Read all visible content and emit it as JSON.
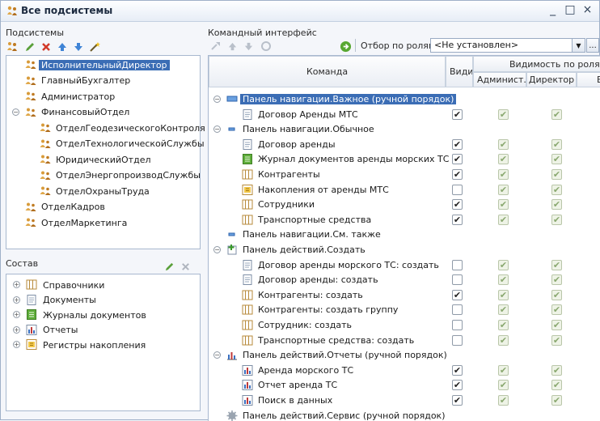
{
  "window": {
    "title": "Все подсистемы",
    "controls": [
      "_",
      "□",
      "×"
    ]
  },
  "subsystems": {
    "label": "Подсистемы",
    "items": [
      {
        "label": "ИсполнительныйДиректор",
        "selected": true,
        "level": 0
      },
      {
        "label": "ГлавныйБухгалтер",
        "level": 0
      },
      {
        "label": "Администратор",
        "level": 0
      },
      {
        "label": "ФинансовыйОтдел",
        "level": 0,
        "expanded": true
      },
      {
        "label": "ОтделГеодезическогоКонтроля",
        "level": 1
      },
      {
        "label": "ОтделТехнологическойСлужбы",
        "level": 1
      },
      {
        "label": "ЮридическийОтдел",
        "level": 1
      },
      {
        "label": "ОтделЭнергопроизводСлужбы",
        "level": 1
      },
      {
        "label": "ОтделОхраныТруда",
        "level": 1
      },
      {
        "label": "ОтделКадров",
        "level": 0
      },
      {
        "label": "ОтделМаркетинга",
        "level": 0
      }
    ]
  },
  "composition": {
    "label": "Состав",
    "items": [
      {
        "label": "Справочники",
        "icon": "catalog-icon"
      },
      {
        "label": "Документы",
        "icon": "document-icon"
      },
      {
        "label": "Журналы документов",
        "icon": "journal-icon"
      },
      {
        "label": "Отчеты",
        "icon": "report-icon"
      },
      {
        "label": "Регистры накопления",
        "icon": "register-icon"
      }
    ]
  },
  "command_interface": {
    "label": "Командный интерфейс",
    "filter_label": "Отбор по ролям:",
    "filter_value": "<Не установлен>",
    "dots": "...",
    "headers": {
      "command": "Команда",
      "visible": "Види...",
      "visibility_by_roles": "Видимость по ролям",
      "role1": "Админист...",
      "role2": "Директор",
      "role3": "Б"
    },
    "rows": [
      {
        "label": "Панель навигации.Важное (ручной порядок)",
        "type": "group",
        "icon": "nav-panel-icon",
        "selected": true
      },
      {
        "label": "Договор Аренды МТС",
        "icon": "document-icon",
        "visible": true,
        "indent": 1
      },
      {
        "label": "Панель навигации.Обычное",
        "type": "group",
        "icon": "nav-panel-small-icon"
      },
      {
        "label": "Договор аренды",
        "icon": "document-icon",
        "visible": true,
        "indent": 1
      },
      {
        "label": "Журнал документов аренды морских ТС",
        "icon": "journal-icon",
        "visible": true,
        "indent": 1
      },
      {
        "label": "Контрагенты",
        "icon": "catalog-icon",
        "visible": true,
        "indent": 1
      },
      {
        "label": "Накопления от аренды МТС",
        "icon": "register-icon",
        "visible": false,
        "indent": 1
      },
      {
        "label": "Сотрудники",
        "icon": "catalog-icon",
        "visible": true,
        "indent": 1
      },
      {
        "label": "Транспортные средства",
        "icon": "catalog-icon",
        "visible": true,
        "indent": 1
      },
      {
        "label": "Панель навигации.См. также",
        "type": "group-leaf",
        "icon": "nav-panel-small-icon"
      },
      {
        "label": "Панель действий.Создать",
        "type": "group",
        "icon": "create-icon"
      },
      {
        "label": "Договор аренды морского ТС: создать",
        "icon": "document-icon",
        "visible": false,
        "indent": 1
      },
      {
        "label": "Договор аренды: создать",
        "icon": "document-icon",
        "visible": false,
        "indent": 1
      },
      {
        "label": "Контрагенты: создать",
        "icon": "catalog-icon",
        "visible": true,
        "indent": 1
      },
      {
        "label": "Контрагенты: создать группу",
        "icon": "catalog-icon",
        "visible": false,
        "indent": 1
      },
      {
        "label": "Сотрудник: создать",
        "icon": "catalog-icon",
        "visible": false,
        "indent": 1
      },
      {
        "label": "Транспортные средства: создать",
        "icon": "catalog-icon",
        "visible": false,
        "indent": 1
      },
      {
        "label": "Панель действий.Отчеты (ручной порядок)",
        "type": "group",
        "icon": "report-chart-icon"
      },
      {
        "label": "Аренда морского ТС",
        "icon": "report-icon",
        "visible": true,
        "indent": 1
      },
      {
        "label": "Отчет аренда ТС",
        "icon": "report-icon",
        "visible": true,
        "indent": 1
      },
      {
        "label": "Поиск в данных",
        "icon": "report-icon",
        "visible": true,
        "indent": 1
      },
      {
        "label": "Панель действий.Сервис (ручной порядок)",
        "type": "group-leaf",
        "icon": "service-gear-icon"
      }
    ]
  },
  "colors": {
    "accent": "#3b6db5",
    "border": "#a8b8cf",
    "checkbox_disabled": "#8aa870"
  }
}
